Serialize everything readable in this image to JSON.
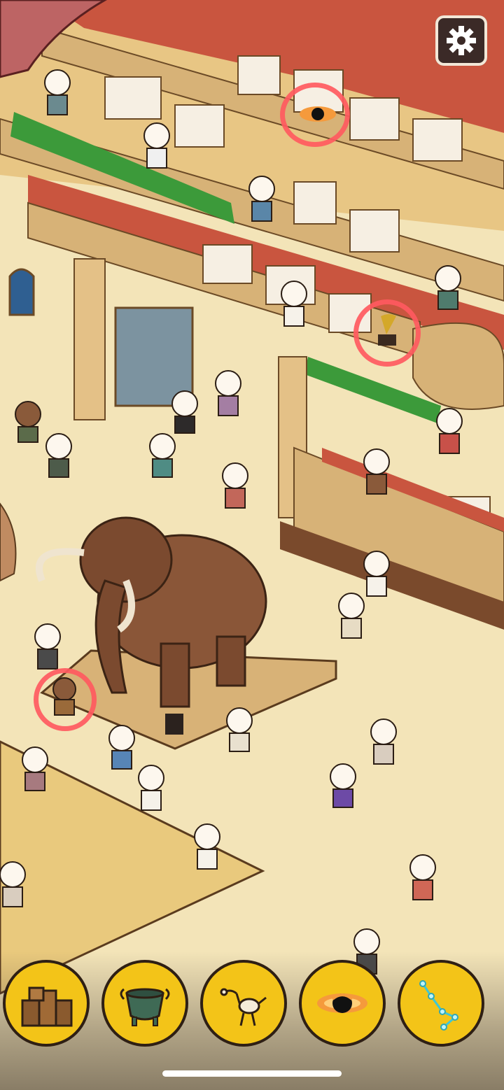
{
  "scene": {
    "name": "museum-hidden-object-scene",
    "colors": {
      "floor": "#f3e4b8",
      "wall": "#e8c684",
      "balcony_floor": "#c9553f",
      "rail": "#d7b277",
      "hedge": "#3c9a3a",
      "found_ring": "#ff5a5f"
    }
  },
  "settings_button": {
    "icon": "gear-icon"
  },
  "found_markers": [
    {
      "item": "black-hole"
    },
    {
      "item": "gramophone"
    },
    {
      "item": "caveman"
    }
  ],
  "toolbar": {
    "colors": {
      "slot_fill": "#f3c418",
      "slot_border": "#2e1f14"
    },
    "items": [
      {
        "icon": "crates-icon",
        "found": false
      },
      {
        "icon": "cauldron-icon",
        "found": false
      },
      {
        "icon": "bird-skeleton-icon",
        "found": false
      },
      {
        "icon": "black-hole-icon",
        "found": true
      },
      {
        "icon": "constellation-icon",
        "found": false
      }
    ]
  }
}
